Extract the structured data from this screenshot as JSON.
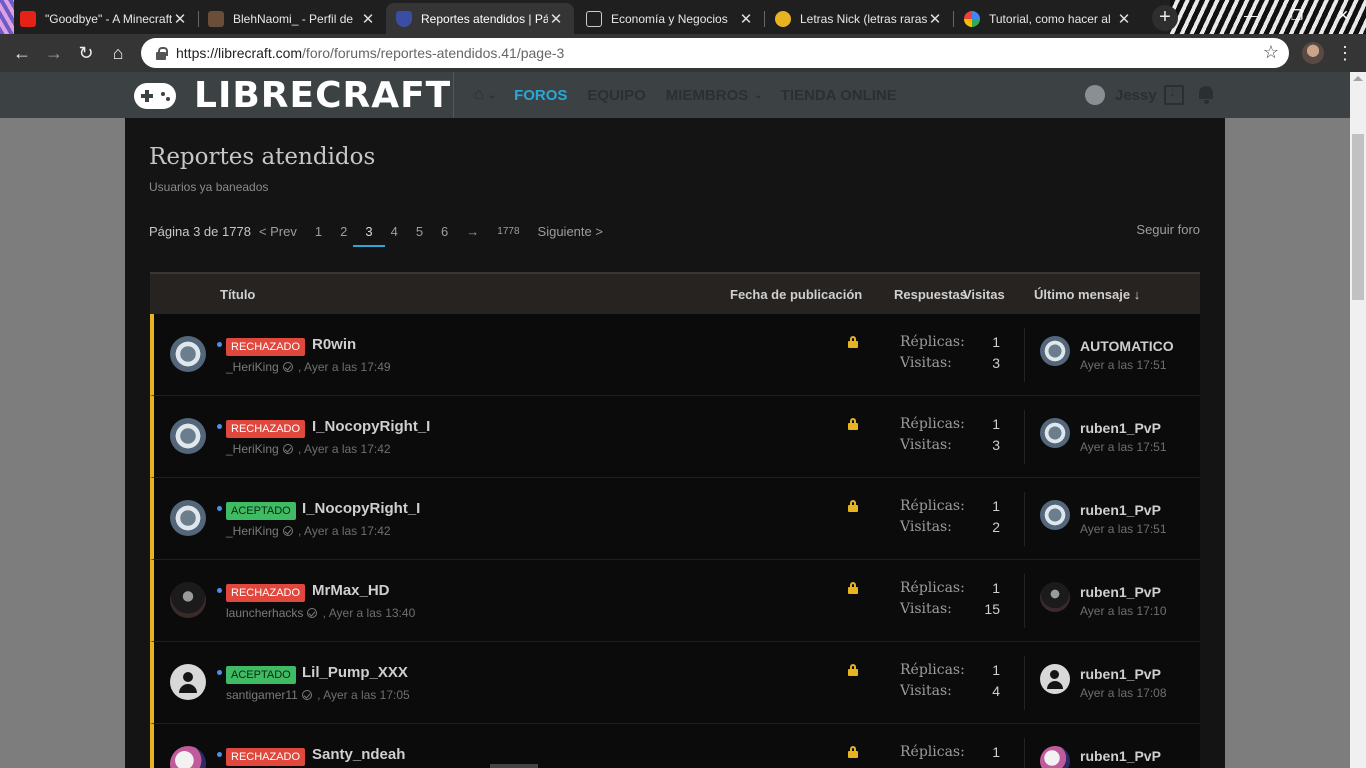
{
  "browser": {
    "tabs": [
      {
        "title": "\"Goodbye\" - A Minecraft",
        "favicon": "youtube-icon",
        "active": false
      },
      {
        "title": "BlehNaomi_ - Perfil de",
        "favicon": "minecraft-head-icon",
        "active": false
      },
      {
        "title": "Reportes atendidos | Pá",
        "favicon": "librecraft-shield-icon",
        "active": true
      },
      {
        "title": "Economía y Negocios",
        "favicon": "document-icon",
        "active": false
      },
      {
        "title": "Letras Nick (letras raras",
        "favicon": "avatar-icon",
        "active": false
      },
      {
        "title": "Tutorial, como hacer al",
        "favicon": "google-icon",
        "active": false
      }
    ],
    "url_domain": "https://librecraft.com",
    "url_path": "/foro/forums/reportes-atendidos.41/page-3"
  },
  "site": {
    "logo_text": "LIBRECRAFT",
    "nav": [
      "FOROS",
      "EQUIPO",
      "MIEMBROS",
      "TIENDA ONLINE"
    ],
    "active_nav": "FOROS",
    "username": "Jessy"
  },
  "forum": {
    "title": "Reportes atendidos",
    "description": "Usuarios ya baneados",
    "follow_label": "Seguir foro",
    "pagination": {
      "label": "Página 3 de 1778",
      "prev": "< Prev",
      "pages": [
        "1",
        "2",
        "3",
        "4",
        "5",
        "6"
      ],
      "current": "3",
      "ellipsis": "→",
      "last": "1778",
      "next": "Siguiente >"
    },
    "columns": {
      "title": "Título",
      "date": "Fecha de publicación",
      "replies": "Respuestas",
      "views": "Visitas",
      "last": "Último mensaje ↓"
    },
    "replies_label": "Réplicas:",
    "views_label": "Visitas:",
    "threads": [
      {
        "status": "RECHAZADO",
        "status_color": "#e0473d",
        "title": "R0win",
        "author": "_HeriKing",
        "date": "Ayer a las 17:49",
        "replies": "1",
        "views": "3",
        "last_user": "AUTOMATICO",
        "last_date": "Ayer a las 17:51",
        "avatar": "logo"
      },
      {
        "status": "RECHAZADO",
        "status_color": "#e0473d",
        "title": "I_NocopyRight_I",
        "author": "_HeriKing",
        "date": "Ayer a las 17:42",
        "replies": "1",
        "views": "3",
        "last_user": "ruben1_PvP",
        "last_date": "Ayer a las 17:51",
        "avatar": "logo"
      },
      {
        "status": "ACEPTADO",
        "status_color": "#3fbb63",
        "title": "I_NocopyRight_I",
        "author": "_HeriKing",
        "date": "Ayer a las 17:42",
        "replies": "1",
        "views": "2",
        "last_user": "ruben1_PvP",
        "last_date": "Ayer a las 17:51",
        "avatar": "logo"
      },
      {
        "status": "RECHAZADO",
        "status_color": "#e0473d",
        "title": "MrMax_HD",
        "author": "launcherhacks",
        "date": "Ayer a las 13:40",
        "replies": "1",
        "views": "15",
        "last_user": "ruben1_PvP",
        "last_date": "Ayer a las 17:10",
        "avatar": "dark"
      },
      {
        "status": "ACEPTADO",
        "status_color": "#3fbb63",
        "title": "Lil_Pump_XXX",
        "author": "santigamer11",
        "date": "Ayer a las 17:05",
        "replies": "1",
        "views": "4",
        "last_user": "ruben1_PvP",
        "last_date": "Ayer a las 17:08",
        "avatar": "default"
      },
      {
        "status": "RECHAZADO",
        "status_color": "#e0473d",
        "title": "Santy_ndeah",
        "author": "",
        "date": "",
        "replies": "1",
        "views": "",
        "last_user": "ruben1_PvP",
        "last_date": "",
        "avatar": "pink"
      }
    ]
  }
}
